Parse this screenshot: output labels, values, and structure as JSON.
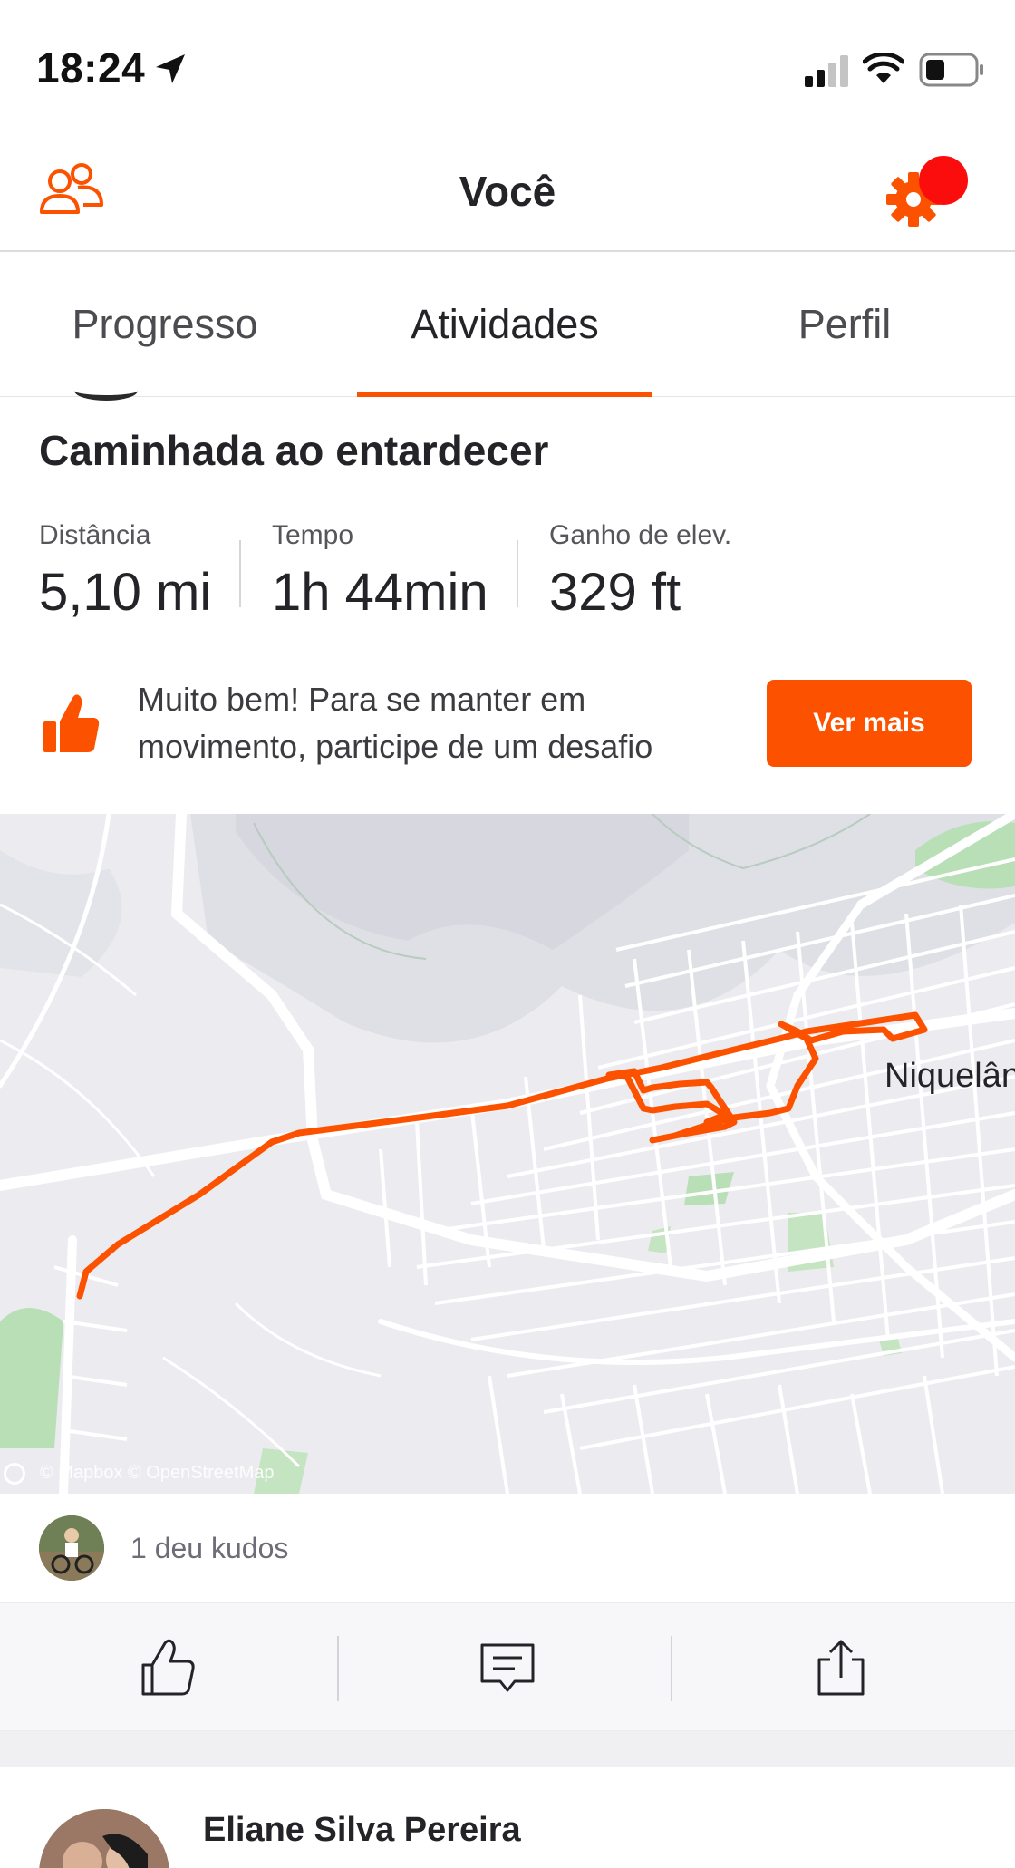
{
  "status_bar": {
    "time": "18:24",
    "icons": [
      "location-arrow-icon",
      "cellular-signal-icon",
      "wifi-icon",
      "battery-icon"
    ]
  },
  "header": {
    "title": "Você",
    "left_icon": "friends-icon",
    "right_icon": "gear-icon",
    "notification_dot_color": "#fc0d0d"
  },
  "tabs": [
    {
      "label": "Progresso",
      "active": false
    },
    {
      "label": "Atividades",
      "active": true
    },
    {
      "label": "Perfil",
      "active": false
    }
  ],
  "activity": {
    "title": "Caminhada ao entardecer",
    "stats": [
      {
        "label": "Distância",
        "value": "5,10 mi"
      },
      {
        "label": "Tempo",
        "value": "1h 44min"
      },
      {
        "label": "Ganho de elev.",
        "value": "329 ft"
      }
    ],
    "promo": {
      "text": "Muito bem! Para se manter em movimento, participe de um desafio",
      "button_label": "Ver mais",
      "icon": "thumbs-up-icon"
    },
    "map": {
      "place_label": "Niquelân",
      "attribution": "© Mapbox © OpenStreetMap",
      "route_color": "#fc5200"
    },
    "kudos": {
      "text": "1 deu kudos"
    },
    "actions": [
      {
        "name": "kudos",
        "icon": "thumbs-up-outline-icon"
      },
      {
        "name": "comment",
        "icon": "comment-icon"
      },
      {
        "name": "share",
        "icon": "share-icon"
      }
    ]
  },
  "next_post": {
    "athlete_name": "Eliane Silva Pereira"
  },
  "colors": {
    "accent": "#fc5200",
    "text_primary": "#242428",
    "text_secondary": "#6d6d78"
  }
}
